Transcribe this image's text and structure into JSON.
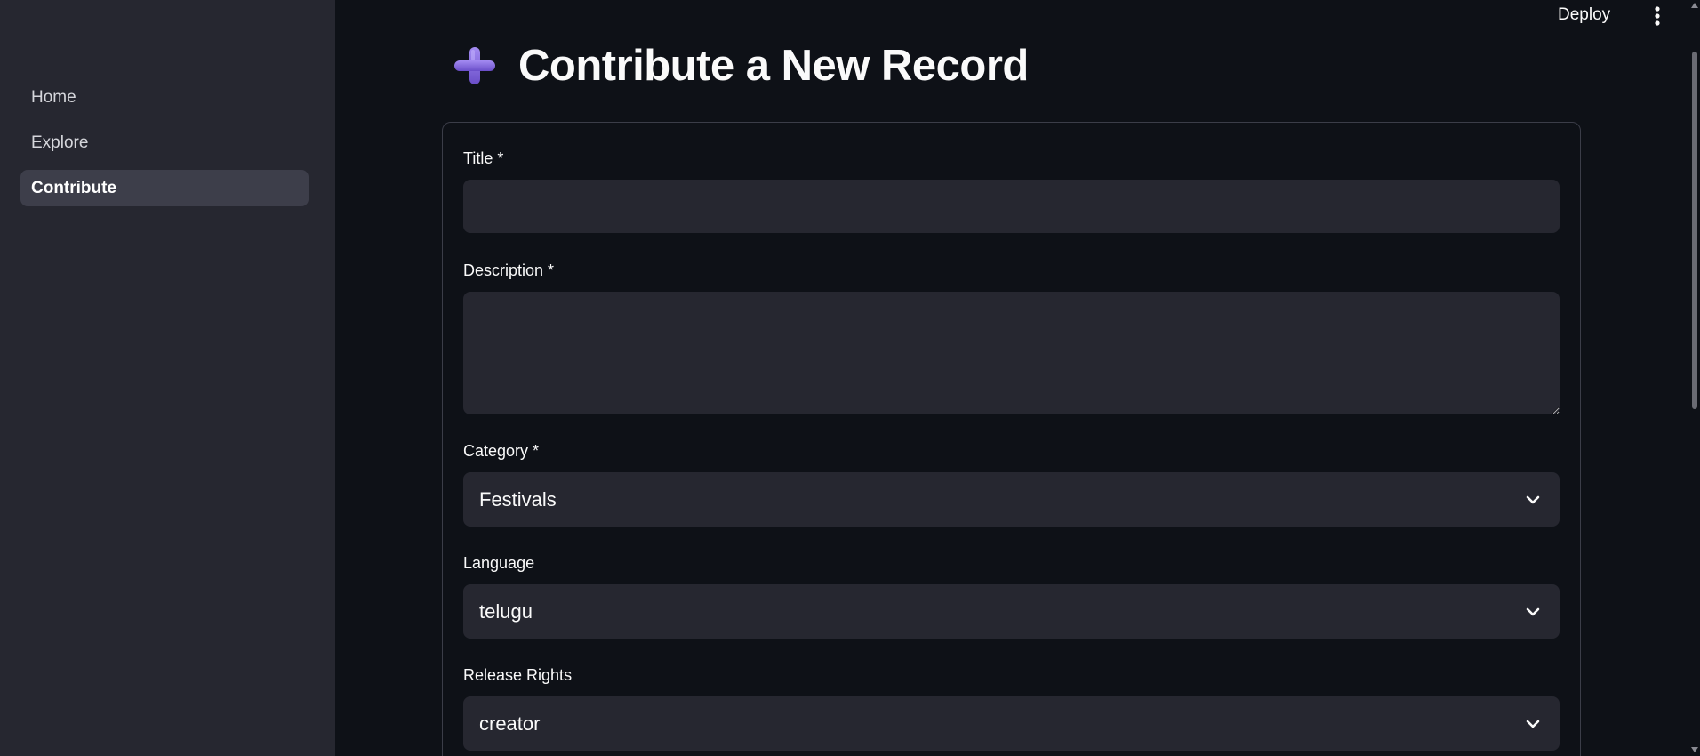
{
  "sidebar": {
    "items": [
      {
        "label": "Home",
        "active": false
      },
      {
        "label": "Explore",
        "active": false
      },
      {
        "label": "Contribute",
        "active": true
      }
    ]
  },
  "header": {
    "deploy_label": "Deploy",
    "menu_icon": "kebab-menu-icon"
  },
  "page": {
    "title": "Contribute a New Record",
    "title_icon": "plus-icon"
  },
  "form": {
    "title": {
      "label": "Title *",
      "value": "",
      "placeholder": ""
    },
    "description": {
      "label": "Description *",
      "value": "",
      "placeholder": ""
    },
    "category": {
      "label": "Category *",
      "value": "Festivals"
    },
    "language": {
      "label": "Language",
      "value": "telugu"
    },
    "release_rights": {
      "label": "Release Rights",
      "value": "creator"
    }
  },
  "colors": {
    "background": "#0e1117",
    "sidebar": "#262730",
    "input": "#262730",
    "accent_icon": "#8b6fe0",
    "text": "#fafafa"
  }
}
